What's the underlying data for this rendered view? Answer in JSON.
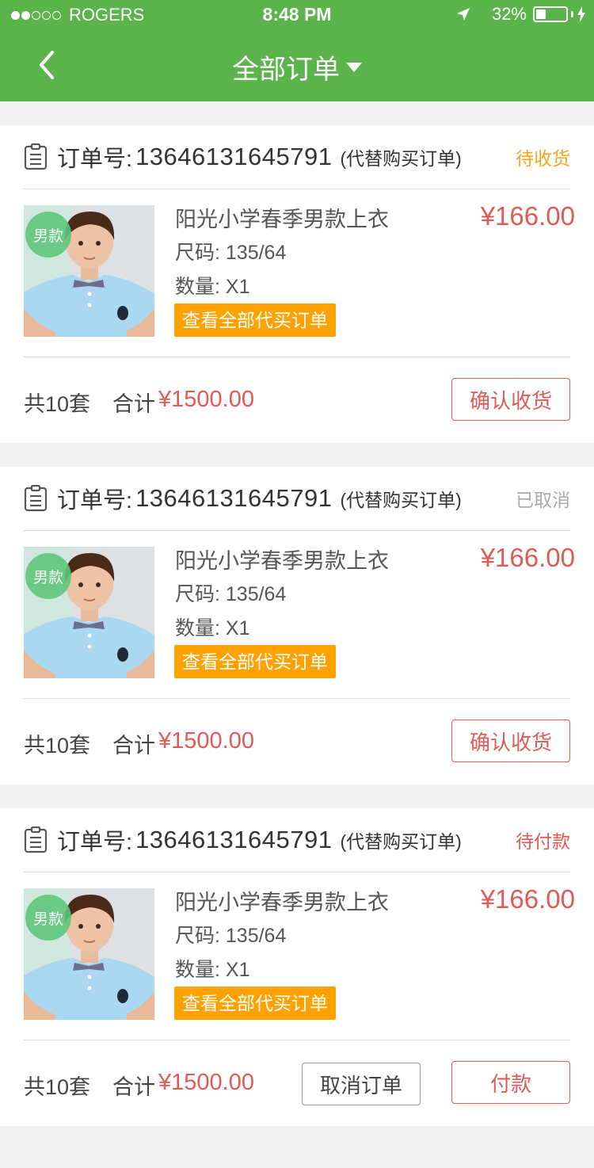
{
  "status_bar": {
    "carrier": "ROGERS",
    "time": "8:48 PM",
    "battery": "32%",
    "battery_level": 0.32
  },
  "nav": {
    "title": "全部订单"
  },
  "orders": [
    {
      "order_label": "订单号:",
      "order_no": "13646131645791",
      "order_note": "(代替购买订单)",
      "status": "待收货",
      "status_color": "#f5a623",
      "badge": "男款",
      "product_name": "阳光小学春季男款上衣",
      "size": "尺码:  135/64",
      "qty": "数量:  X1",
      "view_all": "查看全部代买订单",
      "price": "¥166.00",
      "total_count": "共10套",
      "total_label": "合计",
      "total_value": "¥1500.00",
      "primary_button": "确认收货"
    },
    {
      "order_label": "订单号:",
      "order_no": "13646131645791",
      "order_note": "(代替购买订单)",
      "status": "已取消",
      "status_color": "#aaaaaa",
      "badge": "男款",
      "product_name": "阳光小学春季男款上衣",
      "size": "尺码:  135/64",
      "qty": "数量:  X1",
      "view_all": "查看全部代买订单",
      "price": "¥166.00",
      "total_count": "共10套",
      "total_label": "合计",
      "total_value": "¥1500.00",
      "primary_button": "确认收货"
    },
    {
      "order_label": "订单号:",
      "order_no": "13646131645791",
      "order_note": "(代替购买订单)",
      "status": "待付款",
      "status_color": "#e05a56",
      "badge": "男款",
      "product_name": "阳光小学春季男款上衣",
      "size": "尺码:  135/64",
      "qty": "数量:  X1",
      "view_all": "查看全部代买订单",
      "price": "¥166.00",
      "total_count": "共10套",
      "total_label": "合计",
      "total_value": "¥1500.00",
      "secondary_button": "取消订单",
      "primary_button": "付款"
    }
  ],
  "colors": {
    "header_green": "#5ab34b",
    "price_red": "#e05a56",
    "orange": "#ffa200"
  }
}
